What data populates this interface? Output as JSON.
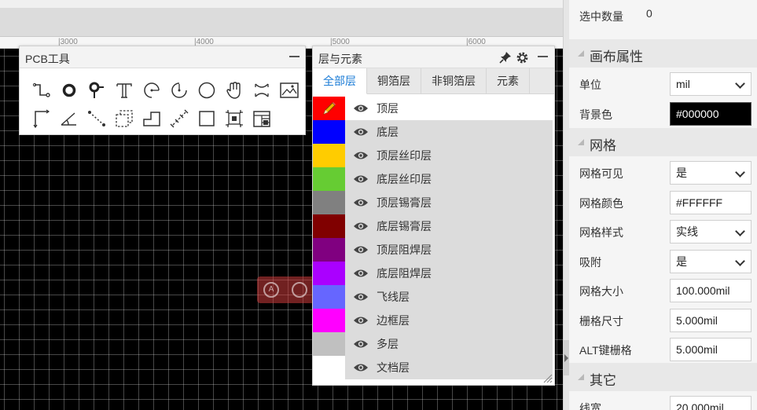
{
  "ruler": {
    "labels": [
      "|3000",
      "|4000",
      "|5000",
      "|6000"
    ]
  },
  "zoom_hint": {
    "icons": [
      "zoom-fit-icon",
      "zoom-search-icon"
    ],
    "glyph": "A"
  },
  "pcb_tools": {
    "title": "PCB工具",
    "tools": [
      "wire-icon",
      "pad-icon",
      "via-icon",
      "text-icon",
      "arc-icon",
      "arc-ccw-icon",
      "circle-icon",
      "pan-hand-icon",
      "connection-icon",
      "image-icon",
      "corner-line-icon",
      "angle-icon",
      "dotted-line-icon",
      "dashed-rect-icon",
      "step-line-icon",
      "ratsnest-icon",
      "rectangle-icon",
      "component-select-icon",
      "table-icon"
    ]
  },
  "layers_panel": {
    "title": "层与元素",
    "tabs": [
      "全部层",
      "铜箔层",
      "非铜箔层",
      "元素"
    ],
    "active_tab": "全部层",
    "layers": [
      {
        "name": "顶层",
        "color": "#FF0000",
        "active": true
      },
      {
        "name": "底层",
        "color": "#0000FF"
      },
      {
        "name": "顶层丝印层",
        "color": "#FFCC00"
      },
      {
        "name": "底层丝印层",
        "color": "#66CC33"
      },
      {
        "name": "顶层锡膏层",
        "color": "#808080"
      },
      {
        "name": "底层锡膏层",
        "color": "#800000"
      },
      {
        "name": "顶层阻焊层",
        "color": "#800080"
      },
      {
        "name": "底层阻焊层",
        "color": "#AA00FF"
      },
      {
        "name": "飞线层",
        "color": "#6666FF"
      },
      {
        "name": "边框层",
        "color": "#FF00FF"
      },
      {
        "name": "多层",
        "color": "#C0C0C0"
      },
      {
        "name": "文档层",
        "color": "#FFFFFF"
      }
    ]
  },
  "properties": {
    "selected_count_label": "选中数量",
    "selected_count": "0",
    "canvas_section": "画布属性",
    "unit_label": "单位",
    "unit_value": "mil",
    "bg_label": "背景色",
    "bg_value": "#000000",
    "grid_section": "网格",
    "grid_visible_label": "网格可见",
    "grid_visible_value": "是",
    "grid_color_label": "网格颜色",
    "grid_color_value": "#FFFFFF",
    "grid_style_label": "网格样式",
    "grid_style_value": "实线",
    "snap_label": "吸附",
    "snap_value": "是",
    "grid_size_label": "网格大小",
    "grid_size_value": "100.000mil",
    "grid_step_label": "栅格尺寸",
    "grid_step_value": "5.000mil",
    "alt_grid_label": "ALT键栅格",
    "alt_grid_value": "5.000mil",
    "other_section": "其它",
    "line_width_label": "线宽",
    "line_width_value": "20.000mil"
  },
  "colors": {
    "accent": "#1c7cd6",
    "canvas": "#000000",
    "grid": "#FFFFFF"
  }
}
